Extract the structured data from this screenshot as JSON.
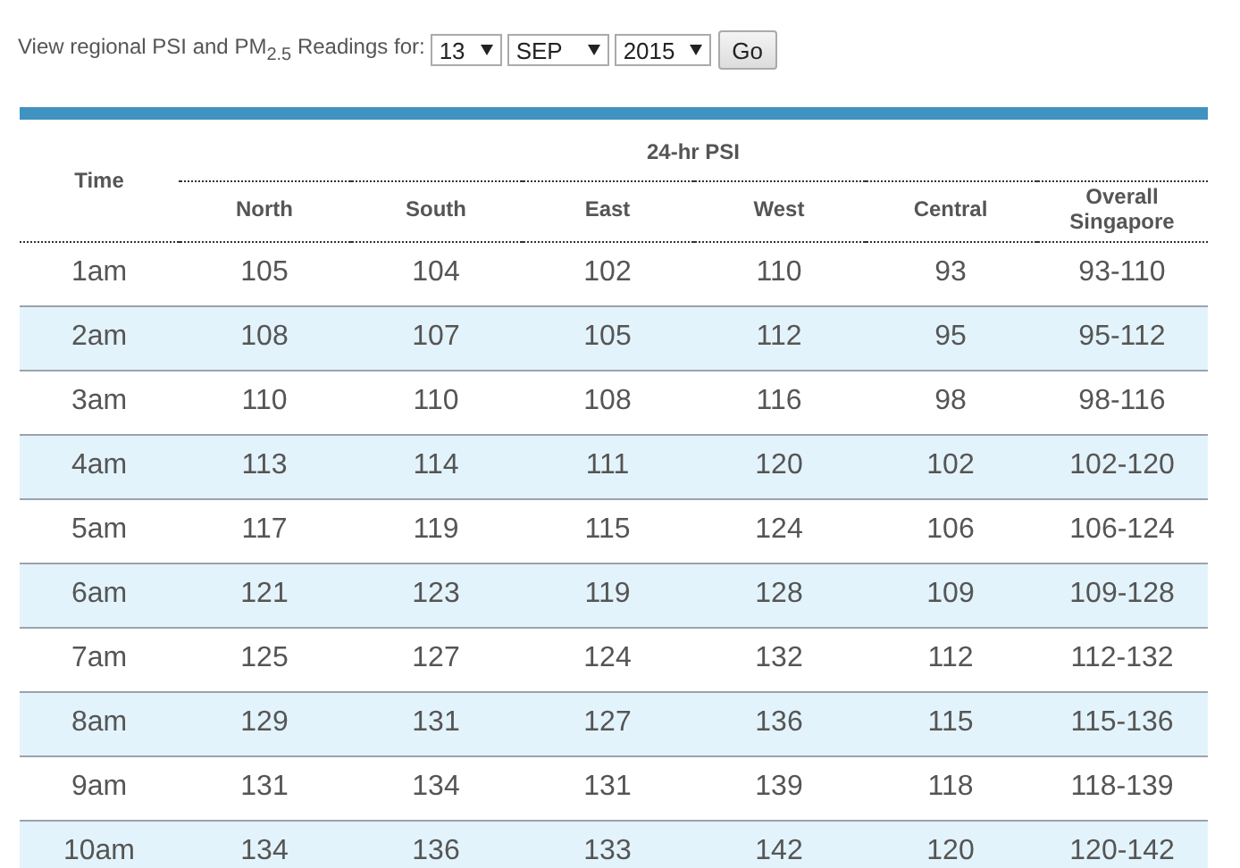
{
  "filter": {
    "label": "View regional PSI and PM$_{2.5}$ Readings for:",
    "dropdowns": [
      {
        "value": "13"
      },
      {
        "value": "SEP"
      },
      {
        "value": "2015"
      }
    ],
    "button": "Go"
  },
  "table": {
    "time_header": "Time",
    "group_header": "24-hr PSI",
    "columns": [
      "North",
      "South",
      "East",
      "West",
      "Central",
      "Overall Singapore"
    ],
    "rows": [
      {
        "time": "1am",
        "cells": [
          "105",
          "104",
          "102",
          "110",
          "93",
          "93-110"
        ]
      },
      {
        "time": "2am",
        "cells": [
          "108",
          "107",
          "105",
          "112",
          "95",
          "95-112"
        ]
      },
      {
        "time": "3am",
        "cells": [
          "110",
          "110",
          "108",
          "116",
          "98",
          "98-116"
        ]
      },
      {
        "time": "4am",
        "cells": [
          "113",
          "114",
          "111",
          "120",
          "102",
          "102-120"
        ]
      },
      {
        "time": "5am",
        "cells": [
          "117",
          "119",
          "115",
          "124",
          "106",
          "106-124"
        ]
      },
      {
        "time": "6am",
        "cells": [
          "121",
          "123",
          "119",
          "128",
          "109",
          "109-128"
        ]
      },
      {
        "time": "7am",
        "cells": [
          "125",
          "127",
          "124",
          "132",
          "112",
          "112-132"
        ]
      },
      {
        "time": "8am",
        "cells": [
          "129",
          "131",
          "127",
          "136",
          "115",
          "115-136"
        ]
      },
      {
        "time": "9am",
        "cells": [
          "131",
          "134",
          "131",
          "139",
          "118",
          "118-139"
        ]
      },
      {
        "time": "10am",
        "cells": [
          "134",
          "136",
          "133",
          "142",
          "120",
          "120-142"
        ]
      }
    ]
  }
}
